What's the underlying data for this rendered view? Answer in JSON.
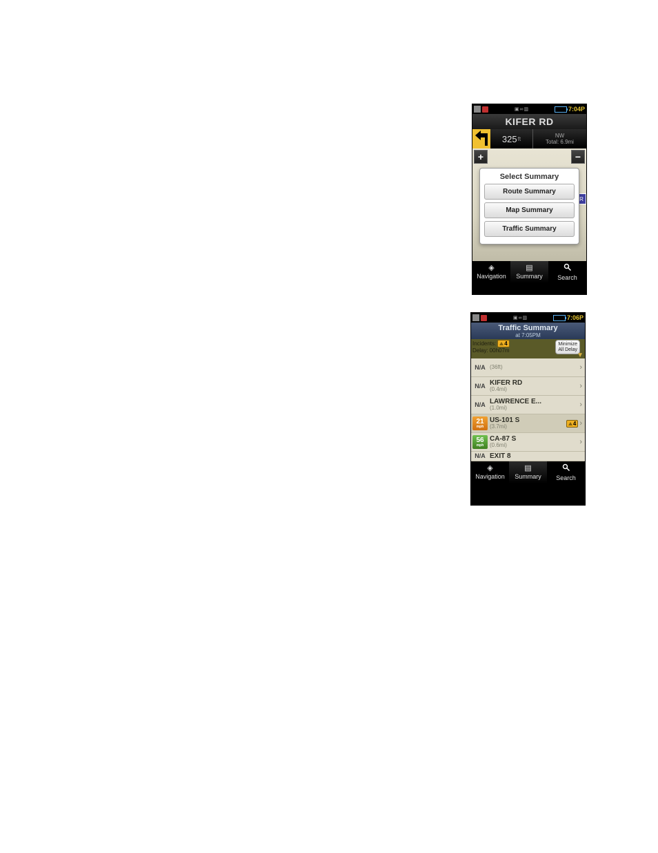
{
  "screen1": {
    "statusbar": {
      "time": "7:04P"
    },
    "road_title": "KIFER RD",
    "nav": {
      "distance_value": "325",
      "distance_unit": "ft",
      "direction": "NW",
      "total": "Total: 6.9mi"
    },
    "zoom_plus": "+",
    "zoom_minus": "−",
    "compass_letter": "R",
    "popup": {
      "title": "Select Summary",
      "buttons": {
        "route": "Route Summary",
        "map": "Map Summary",
        "traffic": "Traffic Summary"
      }
    },
    "bottomnav": {
      "navigation": "Navigation",
      "summary": "Summary",
      "search": "Search"
    }
  },
  "screen2": {
    "statusbar": {
      "time": "7:06P"
    },
    "header": {
      "title": "Traffic Summary",
      "subtitle": "at 7:05PM"
    },
    "meta": {
      "incidents_label": "Incidents:",
      "incidents_count": "4",
      "delay_label": "Delay:",
      "delay_value": "00h07m",
      "minimize_line1": "Minimize",
      "minimize_line2": "All Delay"
    },
    "rows": [
      {
        "speed": "N/A",
        "speed_type": "na",
        "road": "",
        "dist": "(36ft)",
        "warn": ""
      },
      {
        "speed": "N/A",
        "speed_type": "na",
        "road": "KIFER RD",
        "dist": "(0.4mi)",
        "warn": ""
      },
      {
        "speed": "N/A",
        "speed_type": "na",
        "road": "LAWRENCE E...",
        "dist": "(1.0mi)",
        "warn": ""
      },
      {
        "speed": "21",
        "speed_type": "orange",
        "unit": "mph",
        "road": "US-101 S",
        "dist": "(3.7mi)",
        "warn": "4"
      },
      {
        "speed": "56",
        "speed_type": "green",
        "unit": "mph",
        "road": "CA-87 S",
        "dist": "(0.6mi)",
        "warn": ""
      },
      {
        "speed": "N/A",
        "speed_type": "na",
        "road": "EXIT 8",
        "dist": "",
        "warn": ""
      }
    ],
    "bottomnav": {
      "navigation": "Navigation",
      "summary": "Summary",
      "search": "Search"
    }
  }
}
